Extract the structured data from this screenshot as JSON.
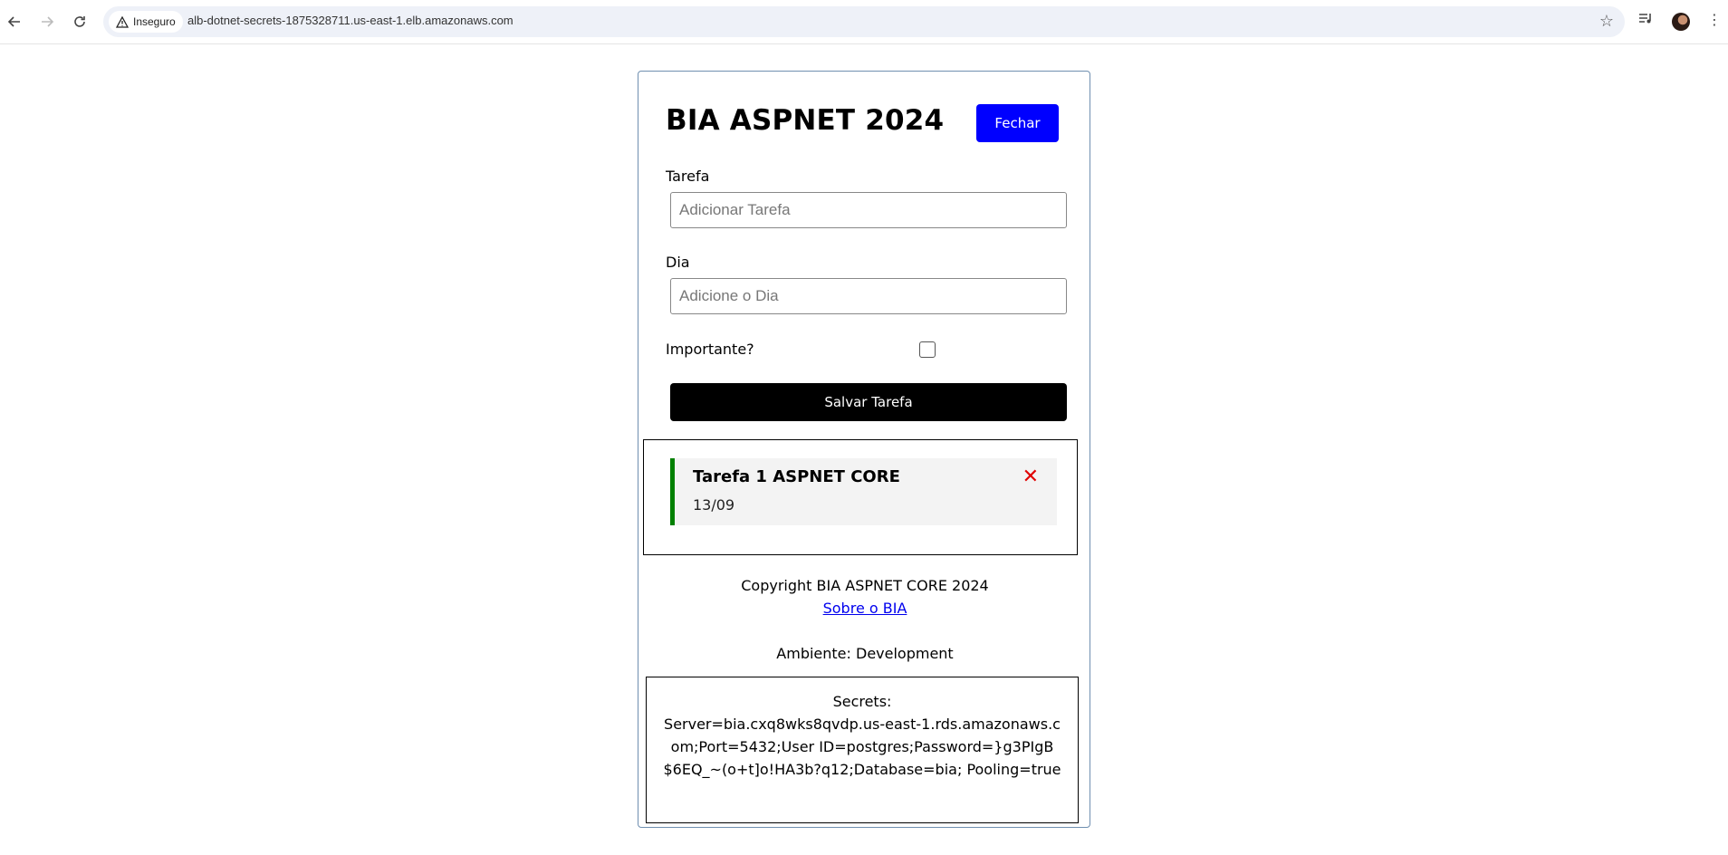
{
  "browser": {
    "security_label": "Inseguro",
    "url": "alb-dotnet-secrets-1875328711.us-east-1.elb.amazonaws.com"
  },
  "app": {
    "title": "BIA ASPNET 2024",
    "close_button": "Fechar",
    "task_label": "Tarefa",
    "task_placeholder": "Adicionar Tarefa",
    "day_label": "Dia",
    "day_placeholder": "Adicione o Dia",
    "important_label": "Importante?",
    "important_checked": false,
    "save_button": "Salvar Tarefa",
    "tasks": [
      {
        "title": "Tarefa 1 ASPNET CORE",
        "day": "13/09",
        "important": true
      }
    ],
    "footer": {
      "copyright": "Copyright BIA ASPNET CORE 2024",
      "about_link": "Sobre o BIA",
      "environment": "Ambiente: Development"
    },
    "secrets": {
      "label": "Secrets:",
      "value": "Server=bia.cxq8wks8qvdp.us-east-1.rds.amazonaws.com;Port=5432;User ID=postgres;Password=}g3PIgB$6EQ_~(o+t]o!HA3b?q12;Database=bia; Pooling=true"
    }
  },
  "colors": {
    "close_button": "#0000ff",
    "save_button": "#000000",
    "task_accent": "#008000",
    "delete": "#e00000"
  }
}
